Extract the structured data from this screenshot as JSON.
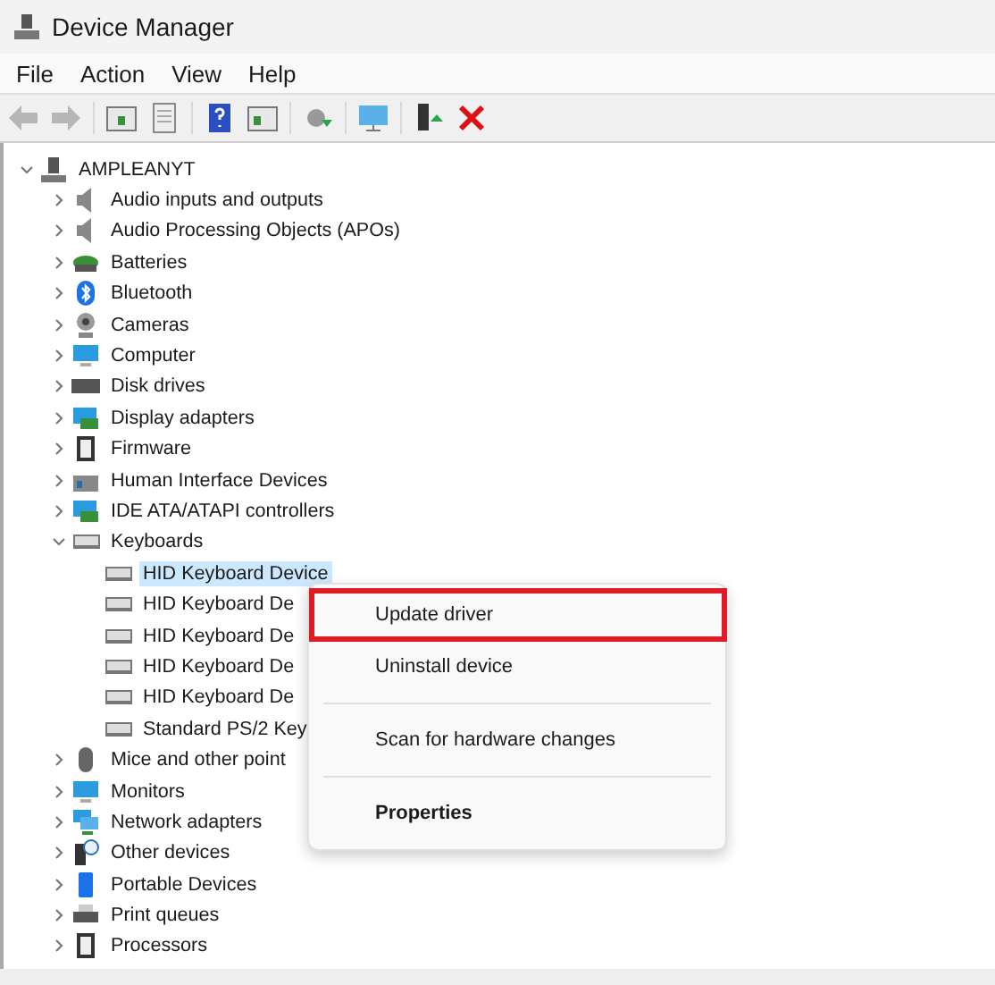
{
  "window": {
    "title": "Device Manager"
  },
  "menu_bar": [
    "File",
    "Action",
    "View",
    "Help"
  ],
  "toolbar": [
    {
      "kind": "back",
      "disabled": true
    },
    {
      "kind": "forward",
      "disabled": true
    },
    {
      "kind": "pane",
      "disabled": false
    },
    {
      "kind": "sheet",
      "disabled": false
    },
    {
      "kind": "help",
      "disabled": false
    },
    {
      "kind": "pane2",
      "disabled": false
    },
    {
      "kind": "update",
      "disabled": false
    },
    {
      "kind": "scan",
      "disabled": false
    },
    {
      "kind": "enable",
      "disabled": false
    },
    {
      "kind": "remove",
      "disabled": false
    }
  ],
  "tree": [
    {
      "label": "AMPLEANYT",
      "kind": "computer",
      "expanded": true,
      "selected": false,
      "children": [
        {
          "label": "Audio inputs and outputs",
          "kind": "audio",
          "expanded": false,
          "selected": false
        },
        {
          "label": "Audio Processing Objects (APOs)",
          "kind": "audio",
          "expanded": false,
          "selected": false
        },
        {
          "label": "Batteries",
          "kind": "battery",
          "expanded": false,
          "selected": false
        },
        {
          "label": "Bluetooth",
          "kind": "bluetooth",
          "expanded": false,
          "selected": false
        },
        {
          "label": "Cameras",
          "kind": "camera",
          "expanded": false,
          "selected": false
        },
        {
          "label": "Computer",
          "kind": "monitor",
          "expanded": false,
          "selected": false
        },
        {
          "label": "Disk drives",
          "kind": "disk",
          "expanded": false,
          "selected": false
        },
        {
          "label": "Display adapters",
          "kind": "display",
          "expanded": false,
          "selected": false
        },
        {
          "label": "Firmware",
          "kind": "chip",
          "expanded": false,
          "selected": false
        },
        {
          "label": "Human Interface Devices",
          "kind": "hid",
          "expanded": false,
          "selected": false
        },
        {
          "label": "IDE ATA/ATAPI controllers",
          "kind": "display",
          "expanded": false,
          "selected": false
        },
        {
          "label": "Keyboards",
          "kind": "keyboard",
          "expanded": true,
          "selected": false,
          "children": [
            {
              "label": "HID Keyboard Device",
              "kind": "keyboard",
              "selected": true
            },
            {
              "label": "HID Keyboard De",
              "kind": "keyboard",
              "selected": false
            },
            {
              "label": "HID Keyboard De",
              "kind": "keyboard",
              "selected": false
            },
            {
              "label": "HID Keyboard De",
              "kind": "keyboard",
              "selected": false
            },
            {
              "label": "HID Keyboard De",
              "kind": "keyboard",
              "selected": false
            },
            {
              "label": "Standard PS/2 Key",
              "kind": "keyboard",
              "selected": false
            }
          ]
        },
        {
          "label": "Mice and other point",
          "kind": "mouse",
          "expanded": false,
          "selected": false
        },
        {
          "label": "Monitors",
          "kind": "monitor",
          "expanded": false,
          "selected": false
        },
        {
          "label": "Network adapters",
          "kind": "network",
          "expanded": false,
          "selected": false
        },
        {
          "label": "Other devices",
          "kind": "other",
          "expanded": false,
          "selected": false
        },
        {
          "label": "Portable Devices",
          "kind": "portable",
          "expanded": false,
          "selected": false
        },
        {
          "label": "Print queues",
          "kind": "printer",
          "expanded": false,
          "selected": false
        },
        {
          "label": "Processors",
          "kind": "chip",
          "expanded": false,
          "selected": false
        }
      ]
    }
  ],
  "context_menu": [
    {
      "label": "Update driver",
      "kind": "item",
      "highlighted": true
    },
    {
      "label": "Uninstall device",
      "kind": "item",
      "highlighted": false
    },
    {
      "kind": "separator"
    },
    {
      "label": "Scan for hardware changes",
      "kind": "item",
      "highlighted": false
    },
    {
      "kind": "separator"
    },
    {
      "label": "Properties",
      "kind": "default",
      "highlighted": false
    }
  ]
}
